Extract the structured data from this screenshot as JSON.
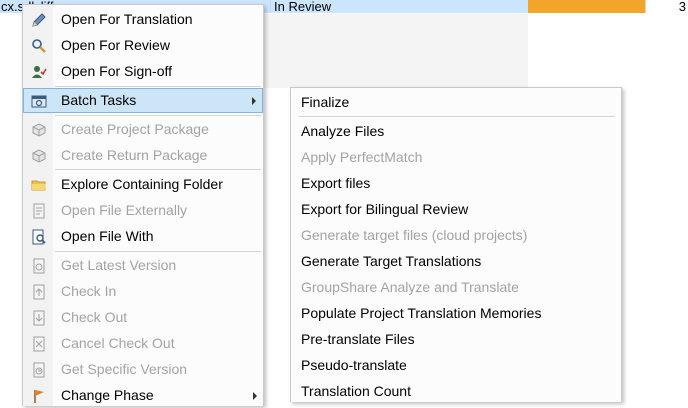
{
  "grid": {
    "file_name": "cx.sdlxliff",
    "status": "In Review",
    "count": "3",
    "progress_fraction": 0.8
  },
  "context_menu": {
    "items": [
      {
        "label": "Open For Translation",
        "icon": "pencil-icon",
        "enabled": true
      },
      {
        "label": "Open For Review",
        "icon": "magnifier-icon",
        "enabled": true
      },
      {
        "label": "Open For Sign-off",
        "icon": "sign-off-user-icon",
        "enabled": true
      },
      {
        "label": "Batch Tasks",
        "icon": "batch-tasks-icon",
        "enabled": true,
        "submenu": true,
        "highlighted": true
      },
      {
        "label": "Create Project Package",
        "icon": "package-icon",
        "enabled": false
      },
      {
        "label": "Create Return Package",
        "icon": "return-package-icon",
        "enabled": false
      },
      {
        "label": "Explore Containing Folder",
        "icon": "folder-icon",
        "enabled": true
      },
      {
        "label": "Open File Externally",
        "icon": "external-file-icon",
        "enabled": false
      },
      {
        "label": "Open File With",
        "icon": "open-with-icon",
        "enabled": true
      },
      {
        "label": "Get Latest Version",
        "icon": "get-latest-icon",
        "enabled": false
      },
      {
        "label": "Check In",
        "icon": "check-in-icon",
        "enabled": false
      },
      {
        "label": "Check Out",
        "icon": "check-out-icon",
        "enabled": false
      },
      {
        "label": "Cancel Check Out",
        "icon": "cancel-check-out-icon",
        "enabled": false
      },
      {
        "label": "Get Specific Version",
        "icon": "specific-version-icon",
        "enabled": false
      },
      {
        "label": "Change Phase",
        "icon": "flag-icon",
        "enabled": true,
        "submenu": true
      }
    ]
  },
  "batch_tasks_menu": {
    "items": [
      {
        "label": "Finalize",
        "enabled": true
      },
      {
        "label": "Analyze Files",
        "enabled": true
      },
      {
        "label": "Apply PerfectMatch",
        "enabled": false
      },
      {
        "label": "Export files",
        "enabled": true
      },
      {
        "label": "Export for Bilingual Review",
        "enabled": true
      },
      {
        "label": "Generate target files (cloud projects)",
        "enabled": false
      },
      {
        "label": "Generate Target Translations",
        "enabled": true
      },
      {
        "label": "GroupShare Analyze and Translate",
        "enabled": false
      },
      {
        "label": "Populate Project Translation Memories",
        "enabled": true
      },
      {
        "label": "Pre-translate Files",
        "enabled": true
      },
      {
        "label": "Pseudo-translate",
        "enabled": true
      },
      {
        "label": "Translation Count",
        "enabled": true
      }
    ]
  },
  "colors": {
    "selection": "#cce5ff",
    "progress": "#f2a52b",
    "highlight": "#cde6f7",
    "disabled_text": "#a3a3a3"
  }
}
